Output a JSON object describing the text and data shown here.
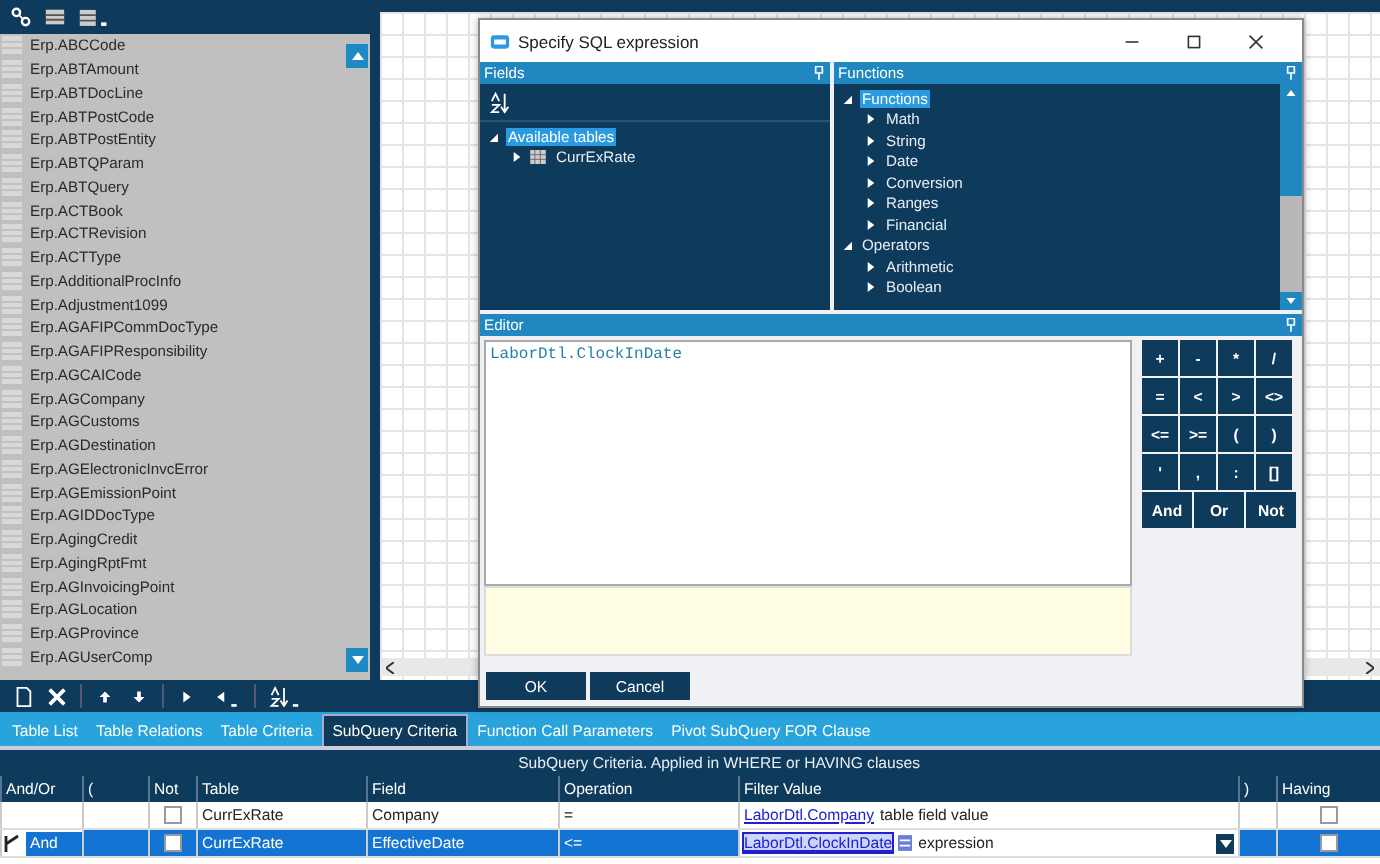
{
  "tables_list": {
    "items": [
      "Erp.ABCCode",
      "Erp.ABTAmount",
      "Erp.ABTDocLine",
      "Erp.ABTPostCode",
      "Erp.ABTPostEntity",
      "Erp.ABTQParam",
      "Erp.ABTQuery",
      "Erp.ACTBook",
      "Erp.ACTRevision",
      "Erp.ACTType",
      "Erp.AdditionalProcInfo",
      "Erp.Adjustment1099",
      "Erp.AGAFIPCommDocType",
      "Erp.AGAFIPResponsibility",
      "Erp.AGCAICode",
      "Erp.AGCompany",
      "Erp.AGCustoms",
      "Erp.AGDestination",
      "Erp.AGElectronicInvcError",
      "Erp.AGEmissionPoint",
      "Erp.AGIDDocType",
      "Erp.AgingCredit",
      "Erp.AgingRptFmt",
      "Erp.AGInvoicingPoint",
      "Erp.AGLocation",
      "Erp.AGProvince",
      "Erp.AGUserComp"
    ]
  },
  "dialog": {
    "title": "Specify SQL expression",
    "fields_panel": {
      "title": "Fields",
      "tree": [
        {
          "label": "Available tables",
          "expanded": true,
          "selected": true,
          "children": [
            {
              "label": "CurrExRate",
              "expanded": false,
              "selected": false
            }
          ]
        }
      ]
    },
    "functions_panel": {
      "title": "Functions",
      "tree": [
        {
          "label": "Functions",
          "expanded": true,
          "selected": true,
          "children": [
            {
              "label": "Math",
              "expanded": false,
              "selected": false
            },
            {
              "label": "String",
              "expanded": false,
              "selected": false
            },
            {
              "label": "Date",
              "expanded": false,
              "selected": false
            },
            {
              "label": "Conversion",
              "expanded": false,
              "selected": false
            },
            {
              "label": "Ranges",
              "expanded": false,
              "selected": false
            },
            {
              "label": "Financial",
              "expanded": false,
              "selected": false
            }
          ]
        },
        {
          "label": "Operators",
          "expanded": true,
          "selected": false,
          "children": [
            {
              "label": "Arithmetic",
              "expanded": false,
              "selected": false
            },
            {
              "label": "Boolean",
              "expanded": false,
              "selected": false
            }
          ]
        }
      ]
    },
    "editor": {
      "title": "Editor",
      "value": "LaborDtl.ClockInDate"
    },
    "keypad": [
      [
        "+",
        "-",
        "*",
        "/"
      ],
      [
        "=",
        "<",
        ">",
        "<>"
      ],
      [
        "<=",
        ">=",
        "(",
        ")"
      ],
      [
        "'",
        ",",
        ":",
        "[]"
      ],
      [
        "And",
        "Or",
        "Not"
      ]
    ],
    "buttons": [
      "OK",
      "Cancel"
    ]
  },
  "tabs": [
    {
      "label": "Table List",
      "selected": false
    },
    {
      "label": "Table Relations",
      "selected": false
    },
    {
      "label": "Table Criteria",
      "selected": false
    },
    {
      "label": "SubQuery Criteria",
      "selected": true
    },
    {
      "label": "Function Call Parameters",
      "selected": false
    },
    {
      "label": "Pivot SubQuery FOR Clause",
      "selected": false
    }
  ],
  "criteria_grid": {
    "caption": "SubQuery Criteria. Applied in WHERE or HAVING clauses",
    "columns": [
      "And/Or",
      "(",
      "Not",
      "Table",
      "Field",
      "Operation",
      "Filter Value",
      ")",
      "Having"
    ],
    "rows": [
      {
        "selected": false,
        "and_or": "",
        "not": false,
        "table": "CurrExRate",
        "field": "Company",
        "operation": "=",
        "filter_link": "LaborDtl.Company",
        "filter_text": "table field value",
        "having": false
      },
      {
        "selected": true,
        "and_or": "And",
        "not": false,
        "table": "CurrExRate",
        "field": "EffectiveDate",
        "operation": "<=",
        "filter_link": "LaborDtl.ClockInDate",
        "filter_text": "expression",
        "having": false
      }
    ]
  }
}
